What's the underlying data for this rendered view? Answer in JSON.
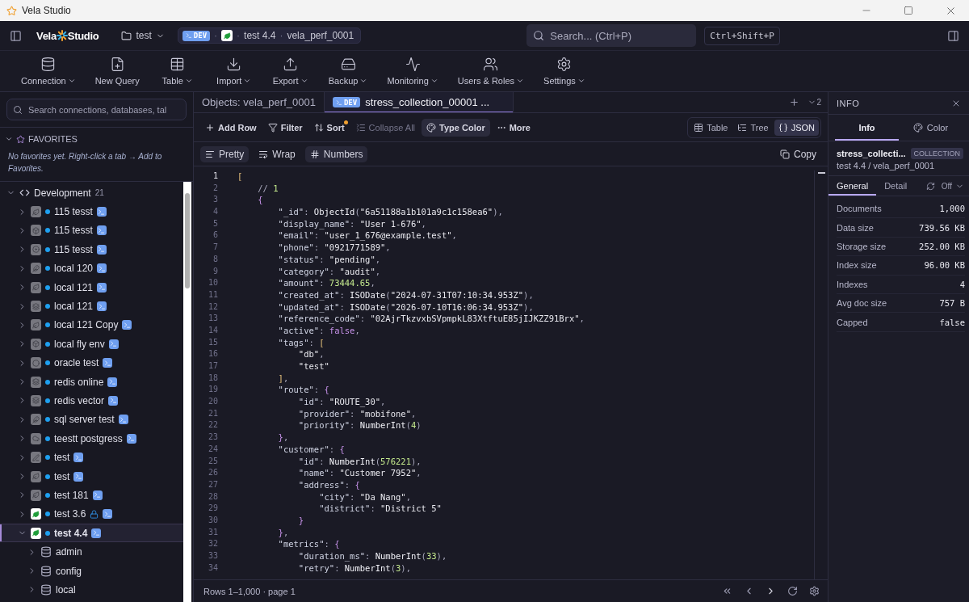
{
  "window": {
    "title": "Vela Studio"
  },
  "topbar": {
    "logo": {
      "left": "Vela",
      "right": "Studio"
    },
    "workspace": "test",
    "breadcrumb": {
      "env": "DEV",
      "connection": "test 4.4",
      "sep": "·",
      "database": "vela_perf_0001"
    },
    "search": {
      "placeholder": "Search... (Ctrl+P)"
    },
    "shortcut": "Ctrl+Shift+P"
  },
  "toolbar": [
    {
      "label": "Connection",
      "menu": true
    },
    {
      "label": "New Query",
      "menu": false
    },
    {
      "label": "Table",
      "menu": true
    },
    {
      "label": "Import",
      "menu": true
    },
    {
      "label": "Export",
      "menu": true
    },
    {
      "label": "Backup",
      "menu": true
    },
    {
      "label": "Monitoring",
      "menu": true
    },
    {
      "label": "Users & Roles",
      "menu": true
    },
    {
      "label": "Settings",
      "menu": true
    }
  ],
  "sidebar": {
    "search": {
      "placeholder": "Search connections, databases, tal"
    },
    "favorites": {
      "title": "FAVORITES",
      "expanded": true,
      "empty": "No favorites yet. Right-click a tab → Add to Favorites."
    },
    "group": {
      "name": "Development",
      "count": "21",
      "expanded": true,
      "connections": [
        {
          "name": "115 tesst",
          "kind": "leaf",
          "connected": false,
          "locked": false,
          "selected": false,
          "expanded": false
        },
        {
          "name": "115 tesst",
          "kind": "cube",
          "connected": false,
          "locked": false,
          "selected": false,
          "expanded": false
        },
        {
          "name": "115 tesst",
          "kind": "disk",
          "connected": false,
          "locked": false,
          "selected": false,
          "expanded": false
        },
        {
          "name": "local 120",
          "kind": "feather",
          "connected": false,
          "locked": false,
          "selected": false,
          "expanded": false
        },
        {
          "name": "local 121",
          "kind": "leaf",
          "connected": false,
          "locked": false,
          "selected": false,
          "expanded": false
        },
        {
          "name": "local 121",
          "kind": "stack",
          "connected": false,
          "locked": false,
          "selected": false,
          "expanded": false
        },
        {
          "name": "local 121 Copy",
          "kind": "leaf",
          "connected": false,
          "locked": false,
          "selected": false,
          "expanded": false
        },
        {
          "name": "local fly env",
          "kind": "cube",
          "connected": false,
          "locked": false,
          "selected": false,
          "expanded": false
        },
        {
          "name": "oracle test",
          "kind": "ring",
          "connected": false,
          "locked": false,
          "selected": false,
          "expanded": false
        },
        {
          "name": "redis online",
          "kind": "stack",
          "connected": false,
          "locked": false,
          "selected": false,
          "expanded": false
        },
        {
          "name": "redis vector",
          "kind": "stack",
          "connected": false,
          "locked": false,
          "selected": false,
          "expanded": false
        },
        {
          "name": "sql server test",
          "kind": "feather",
          "connected": false,
          "locked": false,
          "selected": false,
          "expanded": false
        },
        {
          "name": "teestt postgress",
          "kind": "elephant",
          "connected": false,
          "locked": false,
          "selected": false,
          "expanded": false
        },
        {
          "name": "test",
          "kind": "pen",
          "connected": false,
          "locked": false,
          "selected": false,
          "expanded": false
        },
        {
          "name": "test",
          "kind": "leaf",
          "connected": false,
          "locked": false,
          "selected": false,
          "expanded": false
        },
        {
          "name": "test 181",
          "kind": "leaf",
          "connected": false,
          "locked": false,
          "selected": false,
          "expanded": false
        },
        {
          "name": "test 3.6",
          "kind": "leaf",
          "connected": true,
          "locked": true,
          "selected": false,
          "expanded": false
        },
        {
          "name": "test 4.4",
          "kind": "leaf",
          "connected": true,
          "locked": false,
          "selected": true,
          "expanded": true,
          "children": [
            {
              "name": "admin"
            },
            {
              "name": "config"
            },
            {
              "name": "local"
            }
          ]
        }
      ]
    }
  },
  "tabs": [
    {
      "label": "Objects: vela_perf_0001",
      "selected": false
    },
    {
      "label": "stress_collection_00001 ...",
      "badge": "DEV",
      "selected": true
    }
  ],
  "tab_count": "2",
  "actions": [
    {
      "label": "Add Row",
      "disabled": false,
      "active": false,
      "dot": false
    },
    {
      "label": "Filter",
      "disabled": false,
      "active": false,
      "dot": false
    },
    {
      "label": "Sort",
      "disabled": false,
      "active": false,
      "dot": true
    },
    {
      "label": "Collapse All",
      "disabled": true,
      "active": false,
      "dot": false
    },
    {
      "label": "Type Color",
      "disabled": false,
      "active": true,
      "dot": false
    },
    {
      "label": "More",
      "disabled": false,
      "active": false,
      "dot": false
    }
  ],
  "views": [
    {
      "label": "Table",
      "selected": false
    },
    {
      "label": "Tree",
      "selected": false
    },
    {
      "label": "JSON",
      "selected": true
    }
  ],
  "json_options": [
    {
      "label": "Pretty",
      "on": true
    },
    {
      "label": "Wrap",
      "on": false
    },
    {
      "label": "Numbers",
      "on": true
    }
  ],
  "copy": "Copy",
  "code": [
    {
      "n": "1",
      "text": "["
    },
    {
      "n": "2",
      "text": "    // 1"
    },
    {
      "n": "3",
      "text": "    {"
    },
    {
      "n": "4",
      "text": "        \"_id\": ObjectId(\"6a51188a1b101a9c1c158ea6\"),"
    },
    {
      "n": "5",
      "text": "        \"display_name\": \"User 1-676\","
    },
    {
      "n": "6",
      "text": "        \"email\": \"user_1_676@example.test\","
    },
    {
      "n": "7",
      "text": "        \"phone\": \"0921771589\","
    },
    {
      "n": "8",
      "text": "        \"status\": \"pending\","
    },
    {
      "n": "9",
      "text": "        \"category\": \"audit\","
    },
    {
      "n": "10",
      "text": "        \"amount\": 73444.65,"
    },
    {
      "n": "11",
      "text": "        \"created_at\": ISODate(\"2024-07-31T07:10:34.953Z\"),"
    },
    {
      "n": "12",
      "text": "        \"updated_at\": ISODate(\"2026-07-10T16:06:34.953Z\"),"
    },
    {
      "n": "13",
      "text": "        \"reference_code\": \"02AjrTkzvxbSVpmpkL83XtftuE85jIJKZZ91Brx\","
    },
    {
      "n": "14",
      "text": "        \"active\": false,"
    },
    {
      "n": "15",
      "text": "        \"tags\": ["
    },
    {
      "n": "16",
      "text": "            \"db\","
    },
    {
      "n": "17",
      "text": "            \"test\""
    },
    {
      "n": "18",
      "text": "        ],"
    },
    {
      "n": "19",
      "text": "        \"route\": {"
    },
    {
      "n": "20",
      "text": "            \"id\": \"ROUTE_30\","
    },
    {
      "n": "21",
      "text": "            \"provider\": \"mobifone\","
    },
    {
      "n": "22",
      "text": "            \"priority\": NumberInt(4)"
    },
    {
      "n": "23",
      "text": "        },"
    },
    {
      "n": "24",
      "text": "        \"customer\": {"
    },
    {
      "n": "25",
      "text": "            \"id\": NumberInt(576221),"
    },
    {
      "n": "26",
      "text": "            \"name\": \"Customer 7952\","
    },
    {
      "n": "27",
      "text": "            \"address\": {"
    },
    {
      "n": "28",
      "text": "                \"city\": \"Da Nang\","
    },
    {
      "n": "29",
      "text": "                \"district\": \"District 5\""
    },
    {
      "n": "30",
      "text": "            }"
    },
    {
      "n": "31",
      "text": "        },"
    },
    {
      "n": "32",
      "text": "        \"metrics\": {"
    },
    {
      "n": "33",
      "text": "            \"duration_ms\": NumberInt(33),"
    },
    {
      "n": "34",
      "text": "            \"retry\": NumberInt(3),"
    }
  ],
  "status_bar": {
    "rows": "Rows 1–1,000 · page 1"
  },
  "info": {
    "title": "INFO",
    "tabs": [
      {
        "label": "Info",
        "selected": true
      },
      {
        "label": "Color",
        "selected": false
      }
    ],
    "name": "stress_collecti...",
    "badge": "COLLECTION",
    "path": "test 4.4 / vela_perf_0001",
    "subtabs": [
      {
        "label": "General",
        "selected": true
      },
      {
        "label": "Detail",
        "selected": false
      }
    ],
    "refresh": "Off",
    "stats": [
      {
        "label": "Documents",
        "value": "1,000"
      },
      {
        "label": "Data size",
        "value": "739.56 KB"
      },
      {
        "label": "Storage size",
        "value": "252.00 KB"
      },
      {
        "label": "Index size",
        "value": "96.00 KB"
      },
      {
        "label": "Indexes",
        "value": "4"
      },
      {
        "label": "Avg doc size",
        "value": "757 B"
      },
      {
        "label": "Capped",
        "value": "false"
      }
    ]
  }
}
